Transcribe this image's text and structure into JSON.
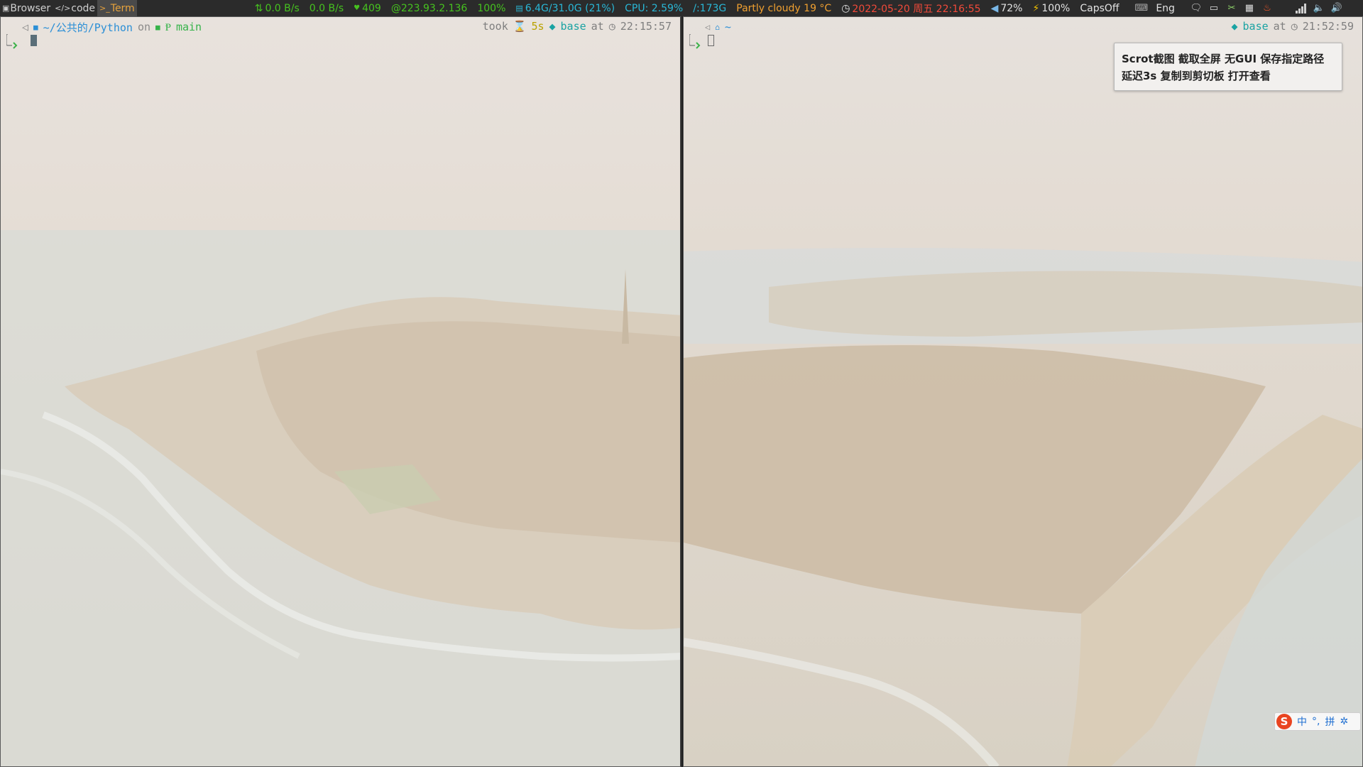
{
  "workspaces": [
    {
      "glyph": "▣",
      "label": "Browser"
    },
    {
      "glyph": "</>",
      "label": "code"
    },
    {
      "glyph": ">_",
      "label": "Term"
    }
  ],
  "status": {
    "net_up": "0.0 B/s",
    "net_down": "0.0 B/s",
    "updates": "409",
    "ip": "@223.93.2.136",
    "brightness": "100%",
    "memory": "6.4G/31.0G (21%)",
    "cpu": "CPU: 2.59%",
    "disk": "/:173G",
    "weather": "Partly cloudy 19 °C",
    "datetime": "2022-05-20 周五 22:16:55",
    "volume": "72%",
    "battery": "100%",
    "capslock": "CapsOff",
    "keyboard_lang": "Eng"
  },
  "tray_icons": [
    "keyboard-icon",
    "chat-icon",
    "laptop-icon",
    "crossed-tools-icon",
    "calculator-icon",
    "flame-app-icon",
    "signal-icon",
    "speaker-icon",
    "volume-icon"
  ],
  "terminals": {
    "left": {
      "path": "~/公共的/Python",
      "on": "on",
      "branch": "main",
      "took_label": "took",
      "duration": "5s",
      "env": "base",
      "at": "at",
      "time": "22:15:57"
    },
    "right": {
      "path": "~",
      "env": "base",
      "at": "at",
      "time": "21:52:59"
    }
  },
  "notification": {
    "line1": "Scrot截图 截取全屏 无GUI 保存指定路径",
    "line2": "延迟3s 复制到剪切板 打开查看"
  },
  "ime": {
    "logo": "S",
    "mode": "中",
    "punct": "°,",
    "pinyin": "拼",
    "settings_glyph": "✲"
  },
  "colors": {
    "statusbar_bg": "#2b2b2b",
    "accent_green": "#46c21f",
    "accent_cyan": "#29b7d6",
    "accent_orange": "#f0a030",
    "accent_red": "#f24a3a",
    "path_blue": "#2c8fd6",
    "git_green": "#36b34a"
  }
}
